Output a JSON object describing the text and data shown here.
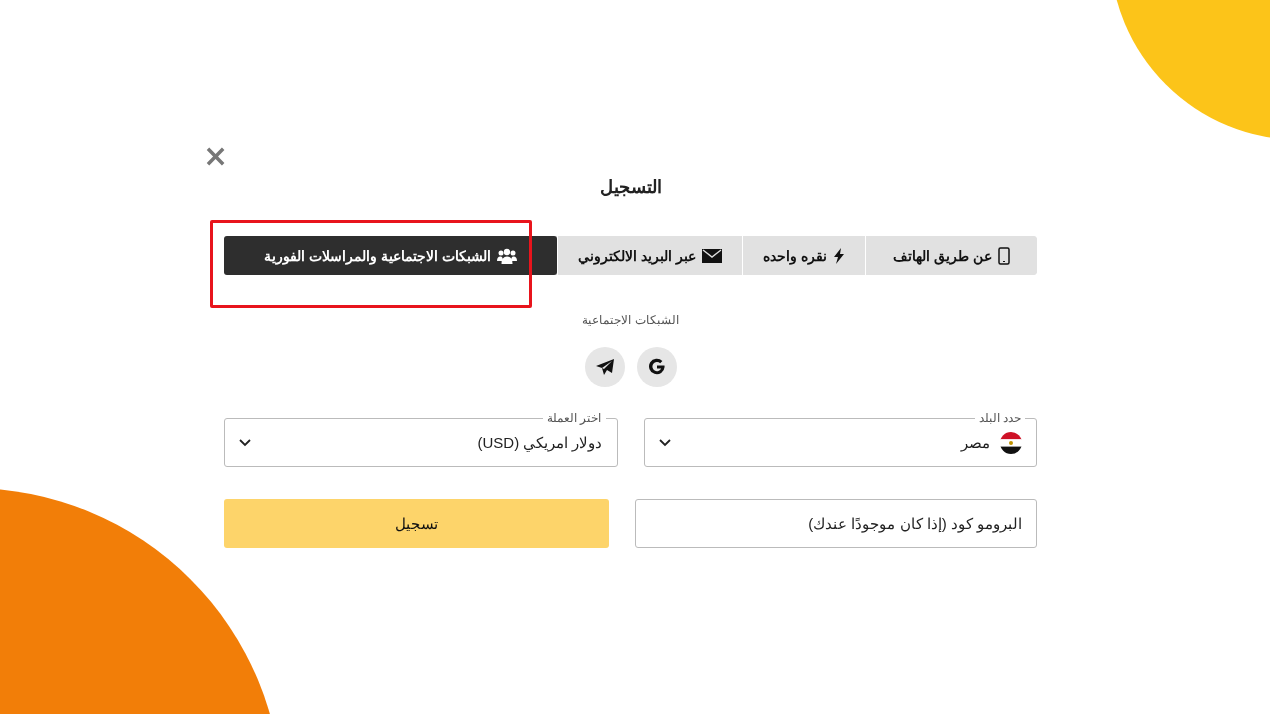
{
  "dialog": {
    "close": "×",
    "title": "التسجيل"
  },
  "tabs": [
    {
      "kind": "phone",
      "label": "عن طريق الهاتف",
      "selected": false
    },
    {
      "kind": "bolt",
      "label": "نقره واحده",
      "selected": false
    },
    {
      "kind": "mail",
      "label": "عبر البريد الالكتروني",
      "selected": false
    },
    {
      "kind": "people",
      "label": "الشبكات الاجتماعية والمراسلات الفورية",
      "selected": true
    }
  ],
  "highlight": {
    "on": true
  },
  "social": {
    "label": "الشبكات الاجتماعية",
    "buttons": [
      {
        "kind": "google"
      },
      {
        "kind": "telegram"
      }
    ]
  },
  "country": {
    "label": "حدد البلد",
    "value": "مصر"
  },
  "currency": {
    "label": "اختر العملة",
    "value": "دولار امريكي (USD)"
  },
  "promo": {
    "placeholder": "البرومو كود (إذا كان موجودًا عندك)"
  },
  "register_button": "تسجيل"
}
